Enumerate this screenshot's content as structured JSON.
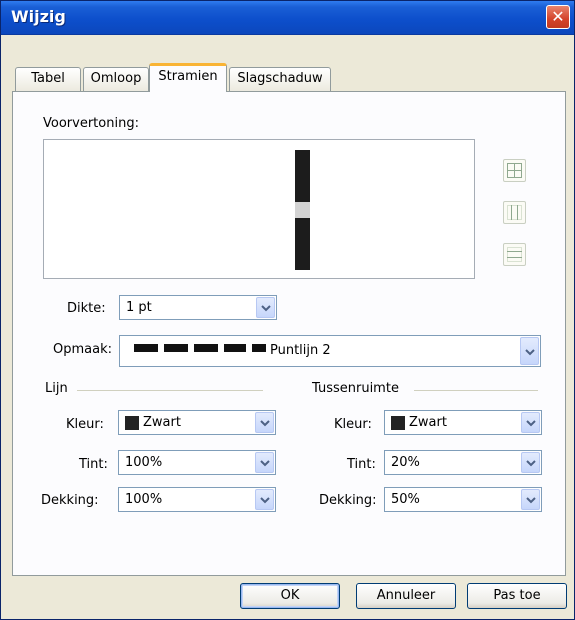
{
  "window": {
    "title": "Wijzig"
  },
  "tabs": [
    {
      "label": "Tabel",
      "active": false
    },
    {
      "label": "Omloop",
      "active": false
    },
    {
      "label": "Stramien",
      "active": true
    },
    {
      "label": "Slagschaduw",
      "active": false
    }
  ],
  "preview": {
    "label": "Voorvertoning:"
  },
  "dikte": {
    "label": "Dikte:",
    "value": "1 pt"
  },
  "opmaak": {
    "label": "Opmaak:",
    "value": "Puntlijn 2"
  },
  "lijn": {
    "heading": "Lijn",
    "kleur_label": "Kleur:",
    "kleur_value": "Zwart",
    "tint_label": "Tint:",
    "tint_value": "100%",
    "dekking_label": "Dekking:",
    "dekking_value": "100%"
  },
  "tussenruimte": {
    "heading": "Tussenruimte",
    "kleur_label": "Kleur:",
    "kleur_value": "Zwart",
    "tint_label": "Tint:",
    "tint_value": "20%",
    "dekking_label": "Dekking:",
    "dekking_value": "50%"
  },
  "buttons": {
    "ok": "OK",
    "cancel": "Annuleer",
    "apply": "Pas toe"
  },
  "colors": {
    "titlebar": "#0d4fcc",
    "swatch": "#222222",
    "tab_accent": "#f9b434"
  },
  "icons": [
    "close-icon",
    "chevron-down-icon",
    "grid-all-icon",
    "grid-vertical-icon",
    "grid-horizontal-icon"
  ]
}
